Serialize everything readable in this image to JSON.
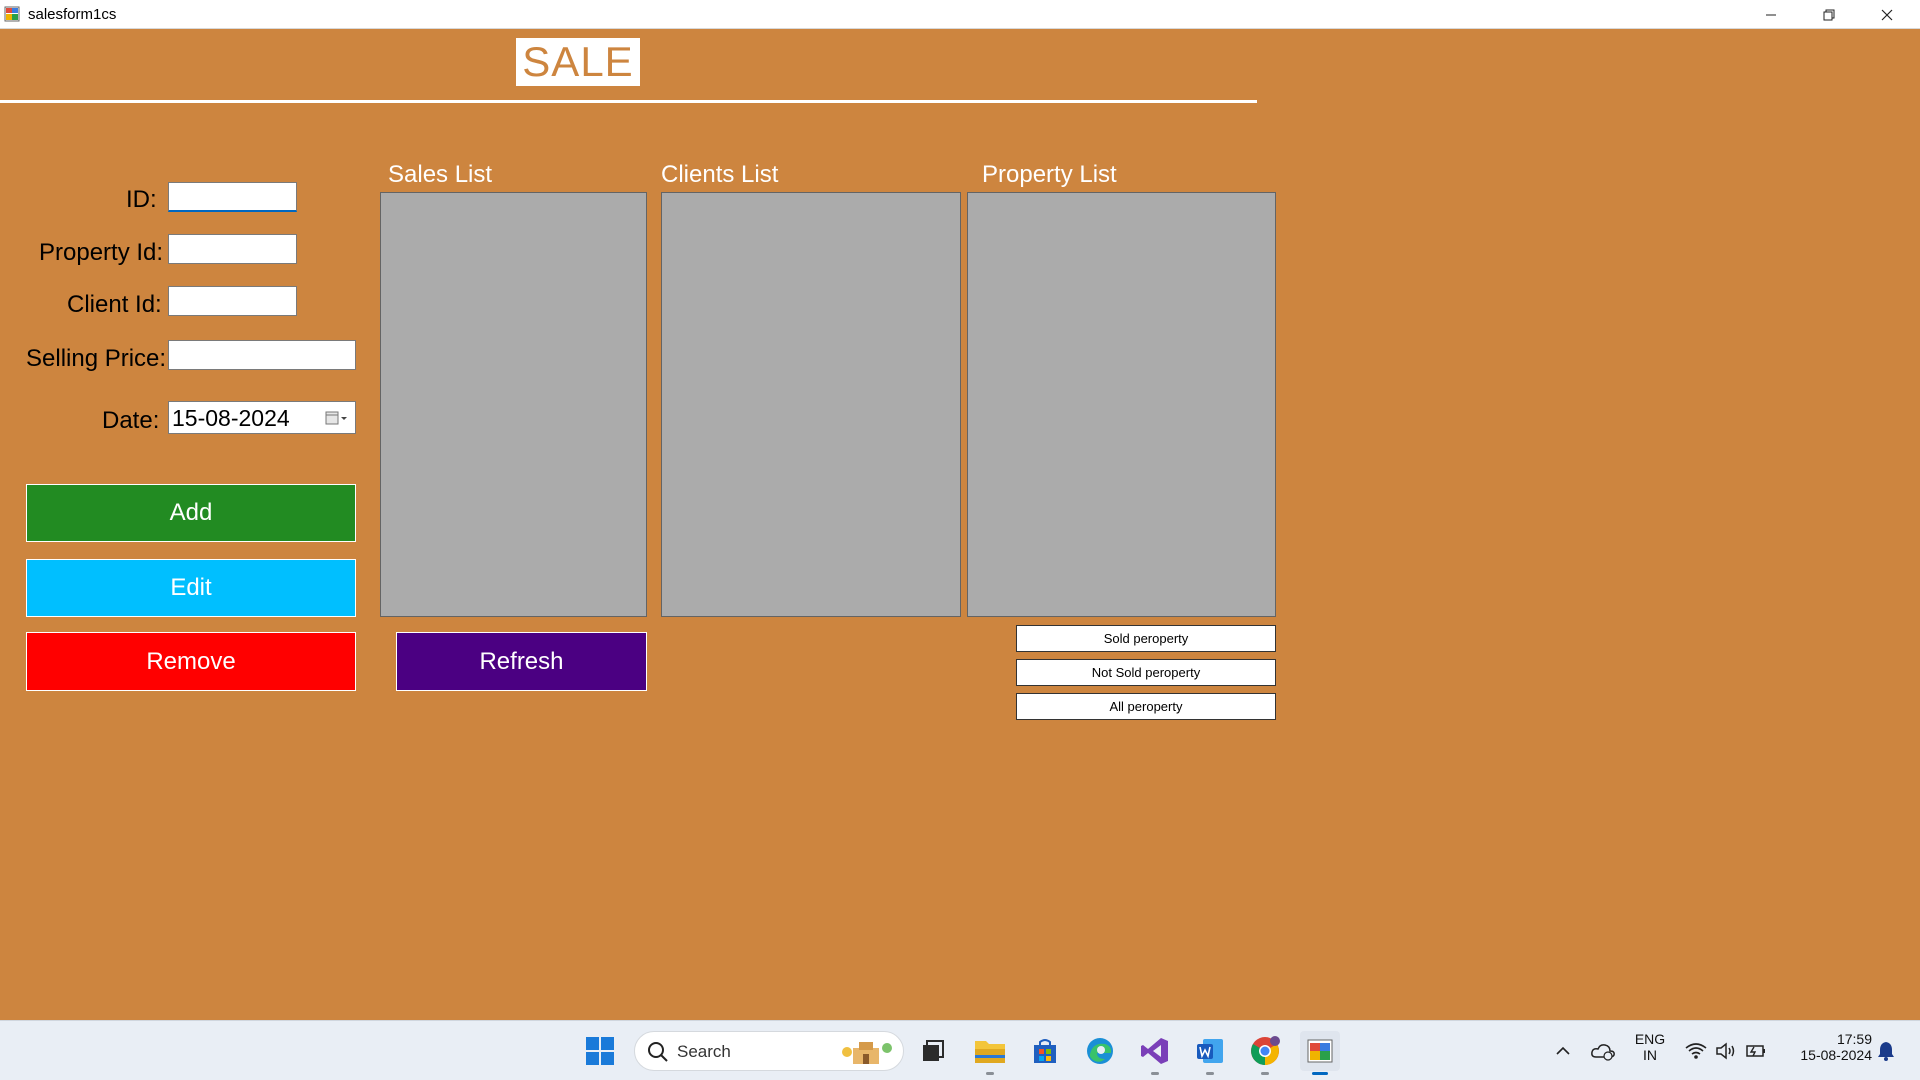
{
  "window": {
    "title": "salesform1cs",
    "min_icon": "minimize-icon",
    "max_icon": "restore-icon",
    "close_icon": "close-icon"
  },
  "form": {
    "header": "SALE",
    "background_color": "#CD853F",
    "fields": {
      "id_label": "ID:",
      "id_value": "",
      "property_label": "Property Id:",
      "property_value": "",
      "client_label": "Client Id:",
      "client_value": "",
      "price_label": "Selling Price:",
      "price_value": "",
      "date_label": "Date:",
      "date_value": "15-08-2024"
    },
    "buttons": {
      "add": "Add",
      "edit": "Edit",
      "remove": "Remove",
      "refresh": "Refresh",
      "add_color": "#228B22",
      "edit_color": "#00BFFF",
      "remove_color": "#FF0000",
      "refresh_color": "#4B0082"
    },
    "grids": {
      "sales_title": "Sales List",
      "clients_title": "Clients List",
      "property_title": "Property List"
    },
    "filters": {
      "sold": "Sold peroperty",
      "not_sold": "Not Sold peroperty",
      "all": "All peroperty"
    }
  },
  "taskbar": {
    "search_label": "Search",
    "language_line1": "ENG",
    "language_line2": "IN",
    "time": "17:59",
    "date": "15-08-2024",
    "icons": [
      "windows-start-icon",
      "search-icon",
      "task-view-icon",
      "file-explorer-icon",
      "microsoft-store-icon",
      "edge-icon",
      "visual-studio-icon",
      "word-icon",
      "chrome-icon",
      "winforms-app-icon",
      "chevron-up-icon",
      "onedrive-icon",
      "wifi-icon",
      "volume-icon",
      "battery-icon",
      "notification-bell-icon"
    ]
  }
}
